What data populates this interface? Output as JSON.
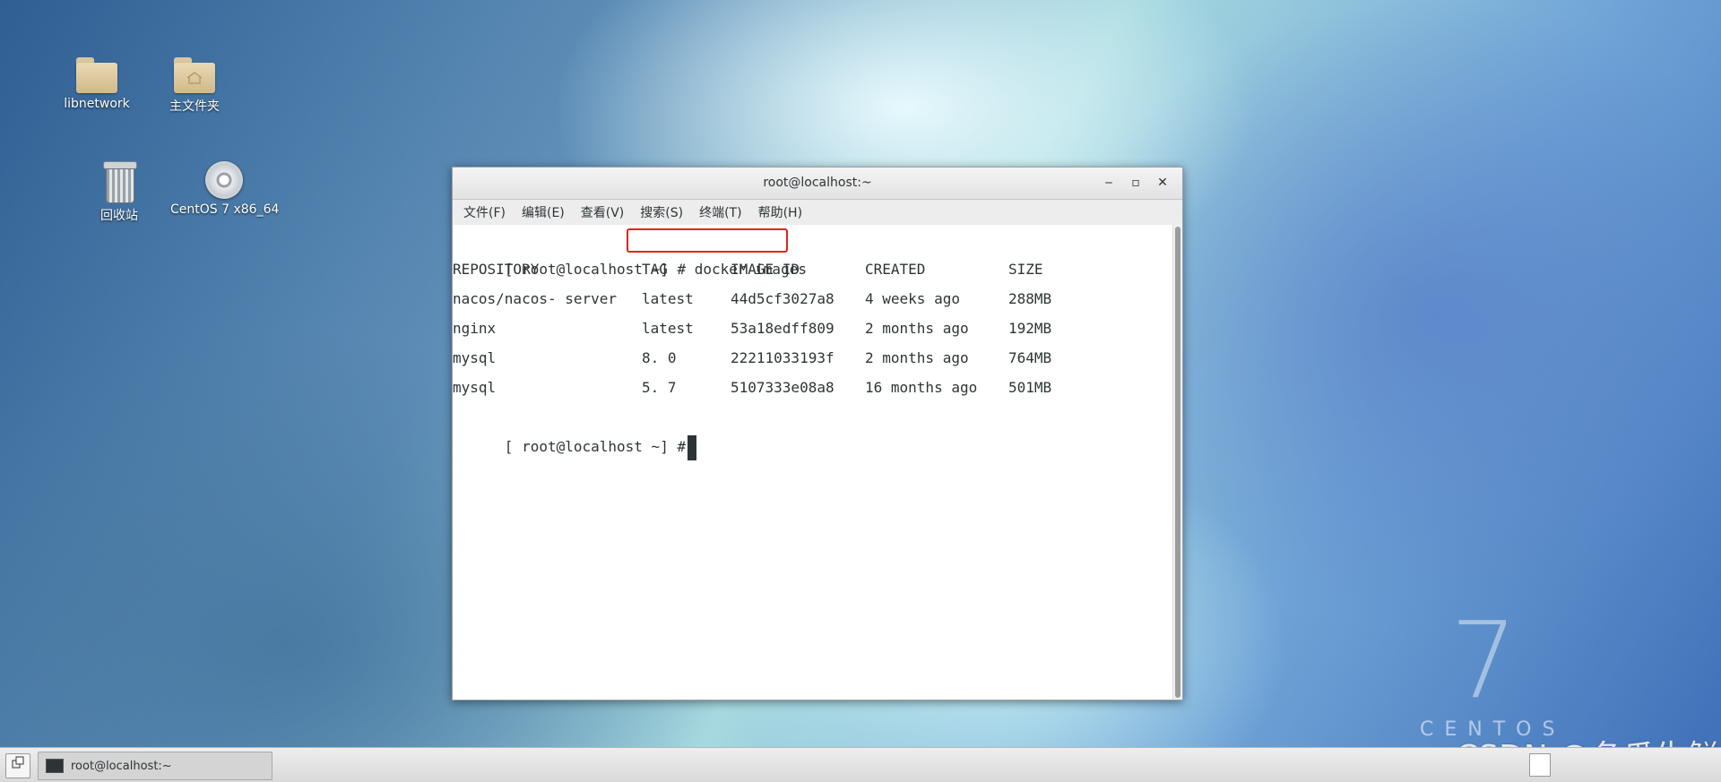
{
  "desktop": {
    "icons": [
      {
        "label": "libnetwork",
        "icon": "folder-icon"
      },
      {
        "label": "主文件夹",
        "icon": "home-folder-icon"
      },
      {
        "label": "回收站",
        "icon": "trash-icon"
      },
      {
        "label": "CentOS 7 x86_64",
        "icon": "disc-icon"
      }
    ],
    "logo_number": "7",
    "logo_text": "CENTOS",
    "watermark": "CSDN @冬瓜生鲜"
  },
  "window": {
    "title": "root@localhost:~",
    "controls": {
      "minimize": "‒",
      "maximize": "▫",
      "close": "✕"
    },
    "menu": [
      "文件(F)",
      "编辑(E)",
      "查看(V)",
      "搜索(S)",
      "终端(T)",
      "帮助(H)"
    ]
  },
  "terminal": {
    "prompt": "[ root@localhost ~] #",
    "command": "docker images",
    "headers": [
      "REPOSITORY",
      "TAG",
      "IMAGE ID",
      "CREATED",
      "SIZE"
    ],
    "rows": [
      [
        "nacos/nacos- server",
        "latest",
        "44d5cf3027a8",
        "4 weeks ago",
        "288MB"
      ],
      [
        "nginx",
        "latest",
        "53a18edff809",
        "2 months ago",
        "192MB"
      ],
      [
        "mysql",
        "8. 0",
        "22211033193f",
        "2 months ago",
        "764MB"
      ],
      [
        "mysql",
        "5. 7",
        "5107333e08a8",
        "16 months ago",
        "501MB"
      ]
    ],
    "prompt2": "[ root@localhost ~] #"
  },
  "taskbar": {
    "task_label": "root@localhost:~"
  }
}
